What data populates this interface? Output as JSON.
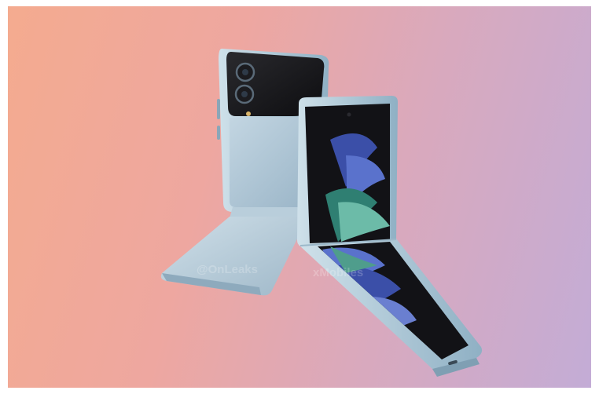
{
  "image": {
    "subject": "Two foldable flip smartphones in light blue, one folded open at an angle showing the back, one showing the front screen with a swirl wallpaper",
    "background_gradient": [
      "#f4ab8f",
      "#eea7a0",
      "#d9a9bd",
      "#c3acd6"
    ],
    "phone_frame_color": "#a9c6d6",
    "back_panel_color": "#b6ccda",
    "screen_color": "#141418",
    "wallpaper_colors": [
      "#4a5fb0",
      "#6a7fd0",
      "#3f8f82",
      "#7fc8b4"
    ]
  },
  "watermarks": [
    {
      "text": "@OnLeaks"
    },
    {
      "text": "xMobiles"
    }
  ]
}
